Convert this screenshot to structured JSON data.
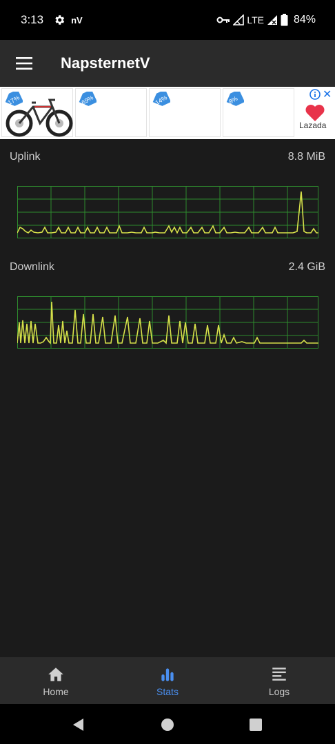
{
  "status_bar": {
    "time": "3:13",
    "app_indicator": "nV",
    "network": "LTE",
    "battery": "84%"
  },
  "app_bar": {
    "title": "NapsternetV"
  },
  "ad": {
    "discounts": [
      "-17%",
      "-69%",
      "-14%",
      "-8%"
    ],
    "brand": "Lazada"
  },
  "stats": {
    "uplink": {
      "label": "Uplink",
      "value": "8.8 MiB"
    },
    "downlink": {
      "label": "Downlink",
      "value": "2.4 GiB"
    }
  },
  "bottom_nav": {
    "items": [
      {
        "label": "Home",
        "icon": "home-icon"
      },
      {
        "label": "Stats",
        "icon": "bar-chart-icon",
        "active": true
      },
      {
        "label": "Logs",
        "icon": "logs-icon"
      }
    ]
  },
  "colors": {
    "graph_line": "#d6e04a",
    "graph_grid": "#2e8b2e",
    "accent": "#4a8ff0",
    "app_bar": "#2b2b2b",
    "background": "#1b1b1b"
  }
}
